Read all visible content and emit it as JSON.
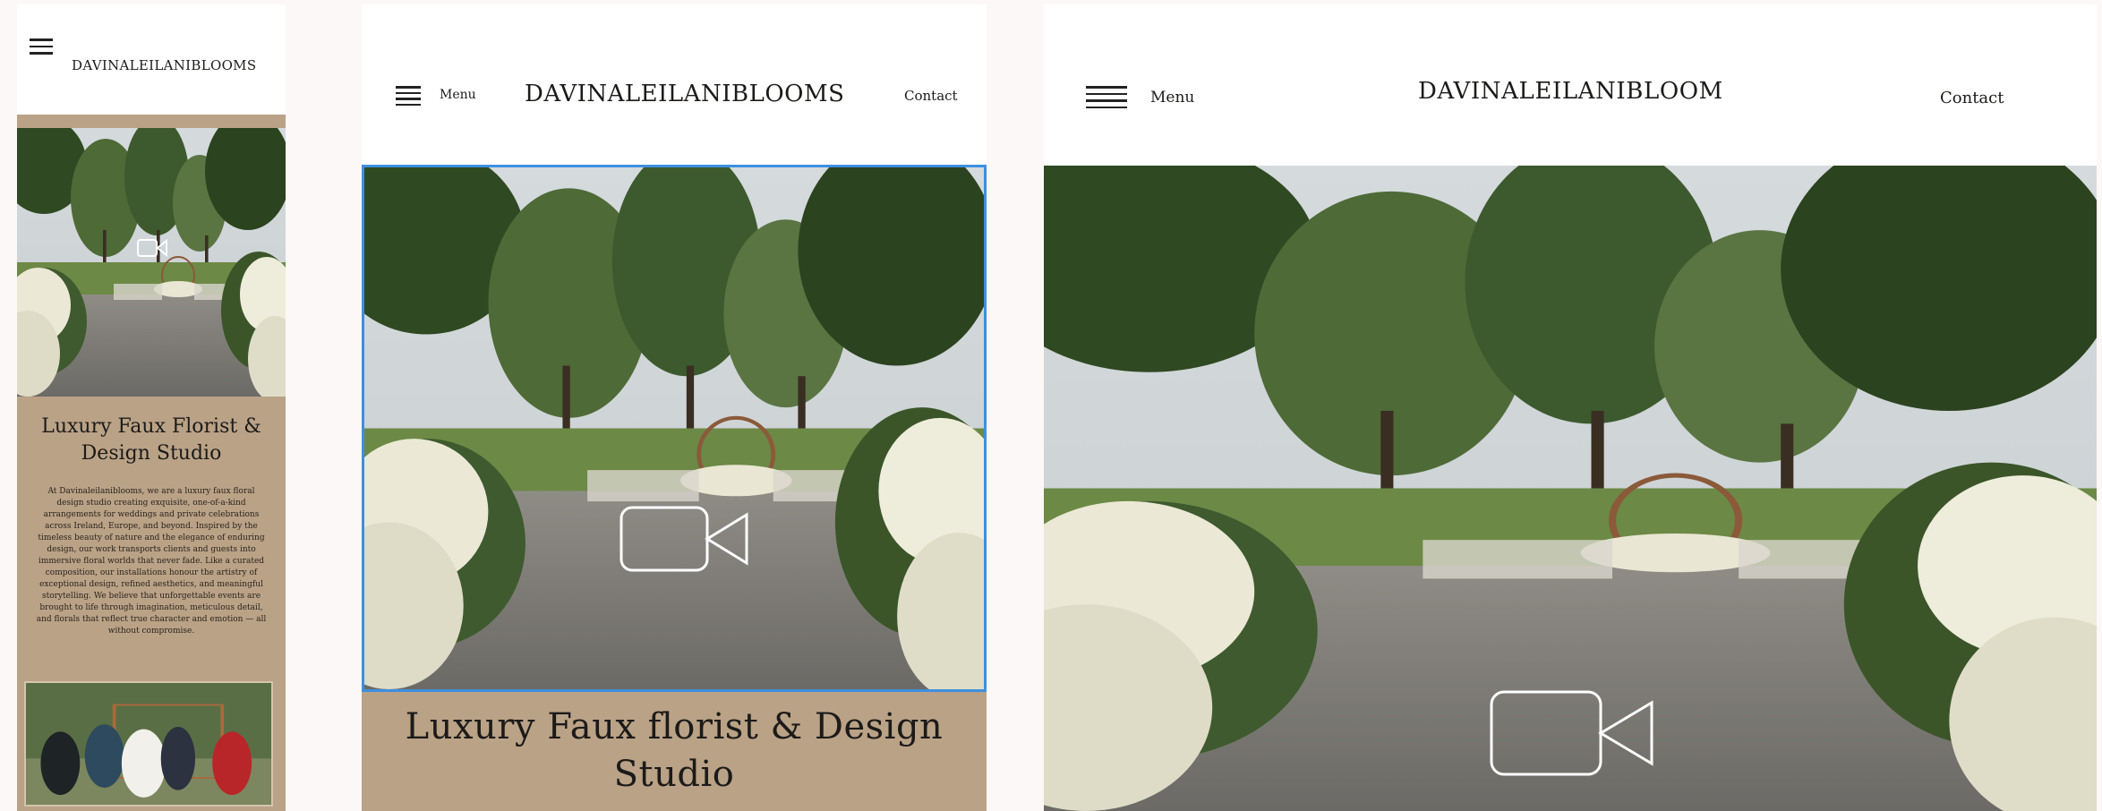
{
  "brand": {
    "mobile_name": "DAVINALEILANIBLOOMS",
    "tablet_name": "DAVINALEILANIBLOOMS",
    "desktop_name": "DAVINALEILANIBLOOM"
  },
  "nav": {
    "menu_label": "Menu",
    "contact_label": "Contact"
  },
  "hero": {
    "mobile_title": "Luxury Faux Florist & Design Studio",
    "tablet_title": "Luxury Faux florist & Design Studio",
    "intro_text": "At Davinaleilaniblooms, we are a luxury faux floral design studio creating exquisite, one-of-a-kind arrangements for weddings and private celebrations across Ireland, Europe, and beyond. Inspired by the timeless beauty of nature and the elegance of enduring design, our work transports clients and guests into immersive floral worlds that never fade. Like a curated composition, our installations honour the artistry of exceptional design, refined aesthetics, and meaningful storytelling. We believe that unforgettable events are brought to life through imagination, meticulous detail, and florals that reflect true character and emotion — all without compromise."
  },
  "icons": {
    "menu": "hamburger-menu-icon",
    "video": "video-camera-icon"
  },
  "colors": {
    "page_bg": "#fcf8f7",
    "header_bg": "#ffffff",
    "beige_panel": "#baa287",
    "selection_outline": "#3f8fe0",
    "text_dark": "#1d1b19"
  }
}
